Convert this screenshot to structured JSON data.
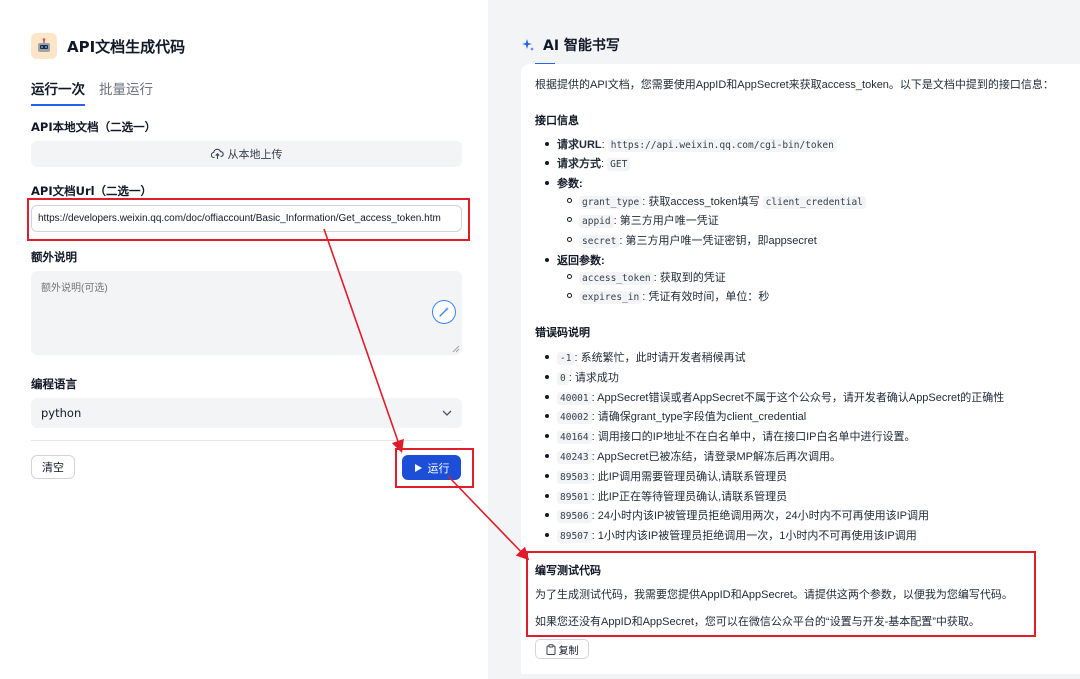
{
  "app": {
    "title": "API文档生成代码"
  },
  "tabs": [
    "运行一次",
    "批量运行"
  ],
  "form": {
    "local_doc_label": "API本地文档（二选一）",
    "upload_label": "从本地上传",
    "url_label": "API文档Url（二选一）",
    "url_value": "https://developers.weixin.qq.com/doc/offiaccount/Basic_Information/Get_access_token.htm",
    "extra_label": "额外说明",
    "extra_placeholder": "额外说明(可选)",
    "lang_label": "编程语言",
    "lang_value": "python",
    "clear_label": "清空",
    "run_label": "运行"
  },
  "panel": {
    "title": "AI 智能书写",
    "intro": "根据提供的API文档，您需要使用AppID和AppSecret来获取access_token。以下是文档中提到的接口信息：",
    "sec_interface": "接口信息",
    "url_key": "请求URL",
    "url_val": "https://api.weixin.qq.com/cgi-bin/token",
    "method_key": "请求方式",
    "method_val": "GET",
    "params_key": "参数",
    "params": [
      {
        "code": "grant_type",
        "desc": "获取access_token填写",
        "code2": "client_credential"
      },
      {
        "code": "appid",
        "desc": "第三方用户唯一凭证"
      },
      {
        "code": "secret",
        "desc": "第三方用户唯一凭证密钥，即appsecret"
      }
    ],
    "return_key": "返回参数",
    "returns": [
      {
        "code": "access_token",
        "desc": "获取到的凭证"
      },
      {
        "code": "expires_in",
        "desc": "凭证有效时间，单位：秒"
      }
    ],
    "sec_errors": "错误码说明",
    "errors": [
      {
        "code": "-1",
        "desc": "系统繁忙，此时请开发者稍候再试"
      },
      {
        "code": "0",
        "desc": "请求成功"
      },
      {
        "code": "40001",
        "desc": "AppSecret错误或者AppSecret不属于这个公众号，请开发者确认AppSecret的正确性"
      },
      {
        "code": "40002",
        "desc": "请确保grant_type字段值为client_credential"
      },
      {
        "code": "40164",
        "desc": "调用接口的IP地址不在白名单中，请在接口IP白名单中进行设置。"
      },
      {
        "code": "40243",
        "desc": "AppSecret已被冻结，请登录MP解冻后再次调用。"
      },
      {
        "code": "89503",
        "desc": "此IP调用需要管理员确认,请联系管理员"
      },
      {
        "code": "89501",
        "desc": "此IP正在等待管理员确认,请联系管理员"
      },
      {
        "code": "89506",
        "desc": "24小时内该IP被管理员拒绝调用两次，24小时内不可再使用该IP调用"
      },
      {
        "code": "89507",
        "desc": "1小时内该IP被管理员拒绝调用一次，1小时内不可再使用该IP调用"
      }
    ],
    "sec_test": "编写测试代码",
    "test_p1": "为了生成测试代码，我需要您提供AppID和AppSecret。请提供这两个参数，以便我为您编写代码。",
    "test_p2": "如果您还没有AppID和AppSecret，您可以在微信公众平台的“设置与开发-基本配置”中获取。",
    "copy_label": "复制"
  },
  "colors": {
    "accent": "#1d4ed8",
    "annotation_red": "#e11d2b"
  }
}
